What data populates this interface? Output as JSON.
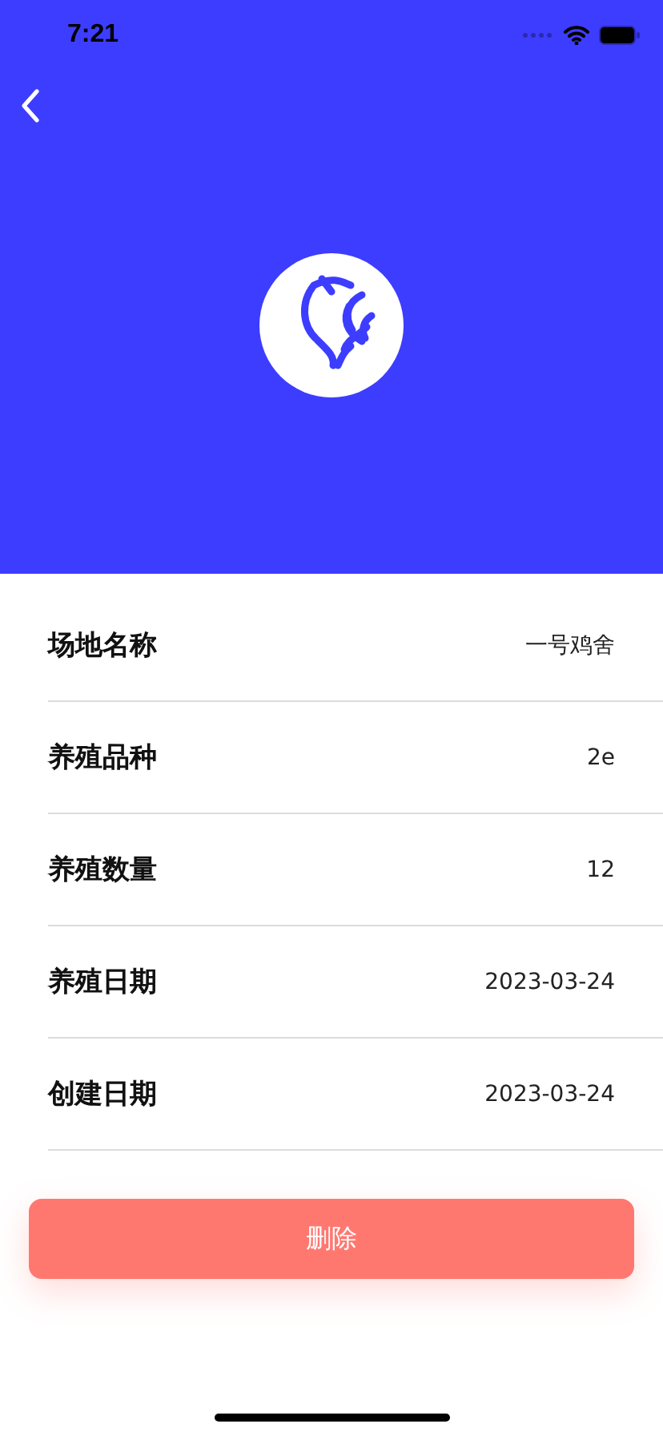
{
  "status_bar": {
    "time": "7:21"
  },
  "fields": [
    {
      "label": "场地名称",
      "value": "一号鸡舍"
    },
    {
      "label": "养殖品种",
      "value": "2e"
    },
    {
      "label": "养殖数量",
      "value": "12"
    },
    {
      "label": "养殖日期",
      "value": "2023-03-24"
    },
    {
      "label": "创建日期",
      "value": "2023-03-24"
    }
  ],
  "delete_button": {
    "label": "删除"
  }
}
